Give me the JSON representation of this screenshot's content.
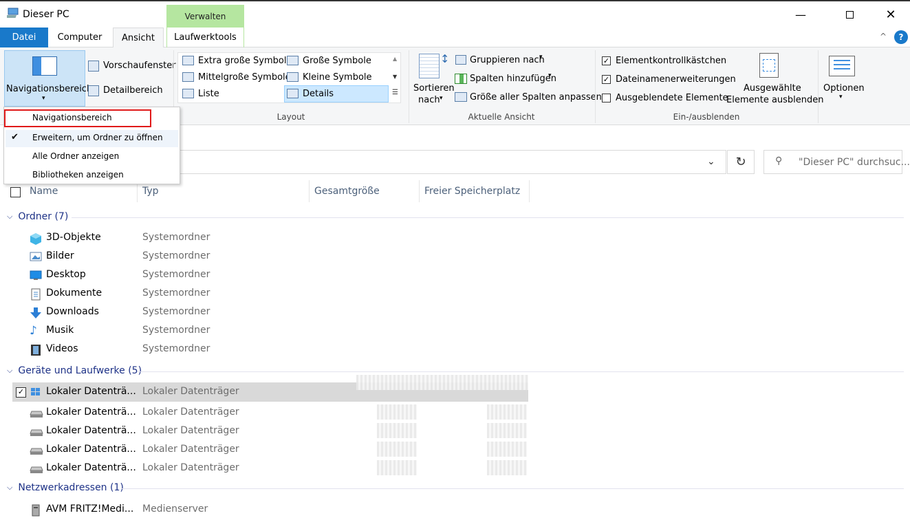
{
  "window": {
    "title": "Dieser PC"
  },
  "context_tab": {
    "label": "Verwalten"
  },
  "tabs": [
    {
      "label": "Datei"
    },
    {
      "label": "Computer"
    },
    {
      "label": "Ansicht"
    },
    {
      "label": "Laufwerktools"
    }
  ],
  "ribbon": {
    "panes": {
      "nav_pane": "Navigationsbereich",
      "preview": "Vorschaufenster",
      "details": "Detailbereich"
    },
    "layout": {
      "label": "Layout",
      "items": [
        "Extra große Symbole",
        "Große Symbole",
        "Mittelgroße Symbole",
        "Kleine Symbole",
        "Liste",
        "Details"
      ]
    },
    "current_view": {
      "label": "Aktuelle Ansicht",
      "sort_line1": "Sortieren",
      "sort_line2": "nach",
      "group_by": "Gruppieren nach",
      "add_columns": "Spalten hinzufügen",
      "fit_columns": "Größe aller Spalten anpassen"
    },
    "show_hide": {
      "label": "Ein-/ausblenden",
      "item_checkboxes": "Elementkontrollkästchen",
      "extensions": "Dateinamenerweiterungen",
      "hidden_items": "Ausgeblendete Elemente",
      "hide_selected_line1": "Ausgewählte",
      "hide_selected_line2": "Elemente ausblenden"
    },
    "options": "Optionen"
  },
  "dropdown": {
    "items": [
      {
        "label": "Navigationsbereich",
        "checked": false
      },
      {
        "label": "Erweitern, um Ordner zu öffnen",
        "checked": true
      },
      {
        "label": "Alle Ordner anzeigen",
        "checked": false
      },
      {
        "label": "Bibliotheken anzeigen",
        "checked": false
      }
    ]
  },
  "search": {
    "placeholder": "\"Dieser PC\" durchsuc..."
  },
  "columns": [
    "Name",
    "Typ",
    "Gesamtgröße",
    "Freier Speicherplatz"
  ],
  "groups": {
    "folders": {
      "title": "Ordner (7)",
      "items": [
        {
          "name": "3D-Objekte",
          "type": "Systemordner",
          "icon": "3d-objects-icon"
        },
        {
          "name": "Bilder",
          "type": "Systemordner",
          "icon": "pictures-icon"
        },
        {
          "name": "Desktop",
          "type": "Systemordner",
          "icon": "desktop-icon"
        },
        {
          "name": "Dokumente",
          "type": "Systemordner",
          "icon": "documents-icon"
        },
        {
          "name": "Downloads",
          "type": "Systemordner",
          "icon": "downloads-icon"
        },
        {
          "name": "Musik",
          "type": "Systemordner",
          "icon": "music-icon"
        },
        {
          "name": "Videos",
          "type": "Systemordner",
          "icon": "videos-icon"
        }
      ]
    },
    "drives": {
      "title": "Geräte und Laufwerke (5)",
      "items": [
        {
          "name": "Lokaler Datenträ...",
          "type": "Lokaler Datenträger",
          "icon": "windows-drive-icon"
        },
        {
          "name": "Lokaler Datenträ...",
          "type": "Lokaler Datenträger",
          "icon": "drive-icon"
        },
        {
          "name": "Lokaler Datenträ...",
          "type": "Lokaler Datenträger",
          "icon": "drive-icon"
        },
        {
          "name": "Lokaler Datenträ...",
          "type": "Lokaler Datenträger",
          "icon": "drive-icon"
        },
        {
          "name": "Lokaler Datenträ...",
          "type": "Lokaler Datenträger",
          "icon": "drive-icon"
        }
      ]
    },
    "network": {
      "title": "Netzwerkadressen (1)",
      "items": [
        {
          "name": "AVM FRITZ!Medi...",
          "type": "Medienserver",
          "icon": "media-server-icon"
        }
      ]
    }
  },
  "colors": {
    "accent": "#1979ca",
    "context_tab": "#b5e6a0",
    "selection": "#cce8ff",
    "highlight_box": "#e01919"
  }
}
